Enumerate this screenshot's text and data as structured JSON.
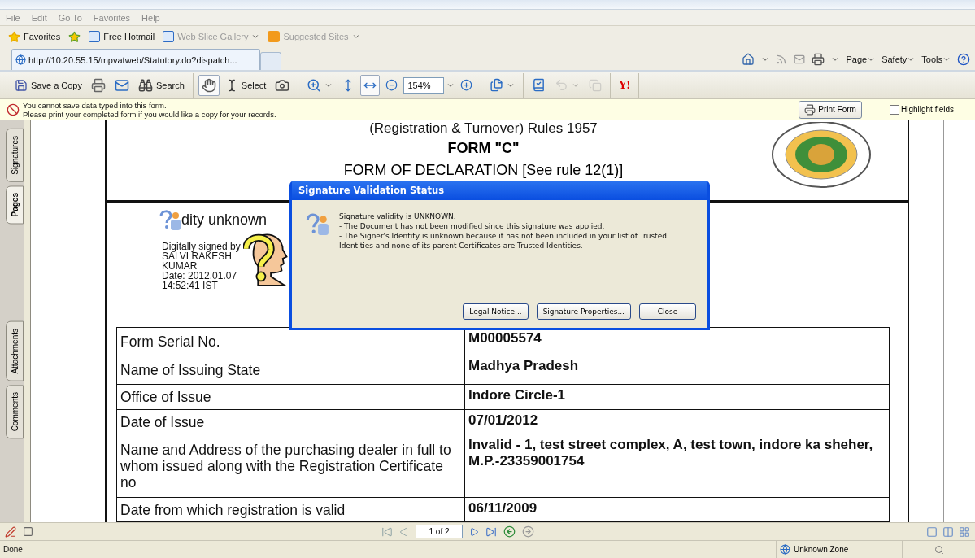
{
  "menu": [
    "File",
    "Edit",
    "Go To",
    "Favorites",
    "Help"
  ],
  "favorites_bar": {
    "favorites": "Favorites",
    "links": [
      {
        "label": "Free Hotmail",
        "disabled": false,
        "dropdown": false
      },
      {
        "label": "Web Slice Gallery",
        "disabled": true,
        "dropdown": true
      },
      {
        "label": "Suggested Sites",
        "disabled": true,
        "dropdown": true
      }
    ]
  },
  "browser_tabs": [
    {
      "label": "http://10.20.55.15/mpvatweb/Statutory.do?dispatch...",
      "selected": true
    }
  ],
  "command_bar": [
    "Page",
    "Safety",
    "Tools"
  ],
  "toolbar": [
    [
      {
        "kind": "save",
        "label": "Save a Copy",
        "pressed": false,
        "disabled": false
      },
      {
        "kind": "print",
        "pressed": false,
        "disabled": false
      },
      {
        "kind": "email",
        "pressed": false,
        "disabled": false
      },
      {
        "kind": "search",
        "label": "Search",
        "pressed": false,
        "disabled": false
      }
    ],
    [
      {
        "kind": "hand",
        "pressed": true,
        "disabled": false
      },
      {
        "kind": "select",
        "label": "Select",
        "pressed": false,
        "disabled": false
      },
      {
        "kind": "snapshot",
        "pressed": false,
        "disabled": false
      }
    ],
    [
      {
        "kind": "zoomtool",
        "pressed": false,
        "disabled": false
      },
      {
        "kind": "fitpage",
        "pressed": false,
        "disabled": false
      },
      {
        "kind": "fitwidth",
        "pressed": true,
        "disabled": false
      },
      {
        "kind": "zoomout",
        "pressed": false,
        "disabled": false
      },
      {
        "kind": "zoomfield",
        "label": "154%",
        "pressed": false,
        "disabled": false
      },
      {
        "kind": "zoomin",
        "pressed": false,
        "disabled": false
      }
    ],
    [
      {
        "kind": "pages",
        "pressed": false,
        "disabled": false
      }
    ],
    [
      {
        "kind": "spell",
        "disabled": false
      },
      {
        "kind": "undo",
        "pressed": false,
        "disabled": true
      },
      {
        "kind": "copy",
        "pressed": false,
        "disabled": true
      }
    ],
    [
      {
        "kind": "yahoo",
        "label": "Y!",
        "pressed": false,
        "disabled": false
      }
    ]
  ],
  "notice": {
    "lines": [
      "You cannot save data typed into this form.",
      "Please print your completed form if you would like a copy for your records."
    ],
    "print_button": "Print Form",
    "highlight": {
      "label": "Highlight fields",
      "checked": false
    }
  },
  "side_tabs": [
    {
      "label": "Signatures",
      "selected": false
    },
    {
      "label": "Pages",
      "selected": true
    },
    {
      "label": "Attachments",
      "selected": false
    },
    {
      "label": "Comments",
      "selected": false
    }
  ],
  "document": {
    "header": "(Registration & Turnover) Rules 1957",
    "form_title": "FORM \"C\"",
    "subtitle": "FORM OF DECLARATION [See rule 12(1)]",
    "signature": {
      "status": "dity unknown",
      "lines": [
        "Digitally signed by",
        "SALVI RAKESH",
        "KUMAR",
        "Date: 2012.01.07",
        "14:52:41 IST"
      ]
    },
    "rows": [
      {
        "label": "Form Serial No.",
        "value": "M00005574"
      },
      {
        "label": "Name of Issuing State",
        "value": "Madhya Pradesh"
      },
      {
        "label": "Office of Issue",
        "value": "Indore Circle-1"
      },
      {
        "label": "Date of Issue",
        "value": "07/01/2012"
      },
      {
        "label": "Name and Address of the purchasing dealer in full to whom issued along with the Registration Certificate no",
        "value": "Invalid - 1, test street complex, A, test town, indore ka sheher, M.P.-23359001754"
      },
      {
        "label": "Date from which registration is valid",
        "value": "06/11/2009"
      }
    ]
  },
  "dialog": {
    "title": "Signature Validation Status",
    "lines": [
      "Signature validity is UNKNOWN.",
      "- The Document has not been modified since this signature was applied.",
      "- The Signer's Identity is unknown because it has not been included in your list of Trusted Identities and none of its parent Certificates are Trusted Identities."
    ],
    "buttons": [
      "Legal Notice...",
      "Signature Properties...",
      "Close"
    ]
  },
  "page_nav": {
    "page": "1 of 2"
  },
  "status_bar": {
    "text": "Done",
    "zone": "Unknown Zone"
  }
}
